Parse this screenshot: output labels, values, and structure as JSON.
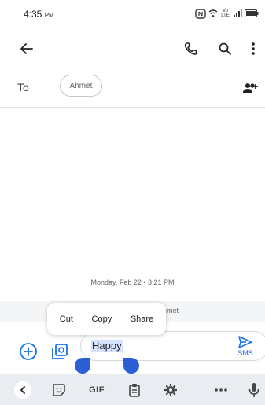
{
  "status_bar": {
    "time": "4:35",
    "ampm": "PM",
    "network": "Vo LTE"
  },
  "compose": {
    "recipient_label": "To",
    "recipient_chip": "Ahmet",
    "message_text": "Happy",
    "send_label": "SMS"
  },
  "conversation": {
    "timestamp": "Monday, Feb 22 • 3:21 PM",
    "participant_fragment": "hmet"
  },
  "context_menu": {
    "cut": "Cut",
    "copy": "Copy",
    "share": "Share"
  },
  "keyboard": {
    "gif_label": "GIF"
  },
  "colors": {
    "accent": "#1a73e8",
    "selection_handle": "#2b5fd6",
    "selection_highlight": "#d6e3ff"
  },
  "icons": [
    "back-arrow-icon",
    "phone-icon",
    "search-icon",
    "more-vert-icon",
    "add-people-icon",
    "add-circle-icon",
    "gallery-icon",
    "send-icon",
    "chevron-left-icon",
    "sticker-icon",
    "clipboard-icon",
    "settings-icon",
    "more-horiz-icon",
    "mic-icon"
  ]
}
